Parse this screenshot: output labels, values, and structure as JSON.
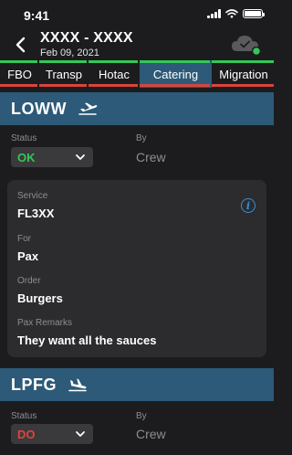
{
  "status_bar": {
    "time": "9:41"
  },
  "header": {
    "title": "XXXX - XXXX",
    "date": "Feb 09, 2021",
    "sync_color": "#34c759"
  },
  "tabs": [
    {
      "label": "FBO",
      "top_color": "#34c759",
      "bottom_color": "#d9453b",
      "active": false
    },
    {
      "label": "Transp",
      "top_color": "#34c759",
      "bottom_color": "#d9453b",
      "active": false
    },
    {
      "label": "Hotac",
      "top_color": "#34c759",
      "bottom_color": "#d9453b",
      "active": false
    },
    {
      "label": "Catering",
      "top_color": "#34c759",
      "bottom_color": "#d9453b",
      "active": true
    },
    {
      "label": "Migration",
      "top_color": "#34c759",
      "bottom_color": "#d9453b",
      "active": false
    }
  ],
  "departure": {
    "code": "LOWW",
    "icon": "airplane-takeoff-icon",
    "status_label": "Status",
    "status_value": "OK",
    "status_color": "#34c759",
    "by_label": "By",
    "by_value": "Crew"
  },
  "details": {
    "service_label": "Service",
    "service_value": "FL3XX",
    "for_label": "For",
    "for_value": "Pax",
    "order_label": "Order",
    "order_value": "Burgers",
    "remarks_label": "Pax Remarks",
    "remarks_value": "They want all the sauces",
    "info_icon": "info-icon"
  },
  "arrival": {
    "code": "LPFG",
    "icon": "airplane-landing-icon",
    "status_label": "Status",
    "status_value": "DO",
    "status_color": "#e0443a",
    "by_label": "By",
    "by_value": "Crew"
  }
}
